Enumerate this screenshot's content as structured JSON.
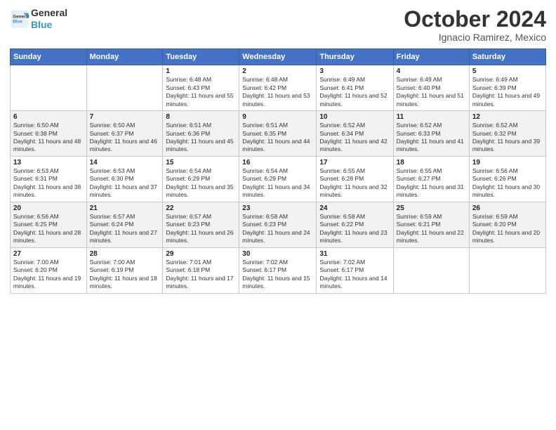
{
  "logo": {
    "line1": "General",
    "line2": "Blue"
  },
  "title": "October 2024",
  "location": "Ignacio Ramirez, Mexico",
  "days_of_week": [
    "Sunday",
    "Monday",
    "Tuesday",
    "Wednesday",
    "Thursday",
    "Friday",
    "Saturday"
  ],
  "weeks": [
    [
      {
        "day": "",
        "info": ""
      },
      {
        "day": "",
        "info": ""
      },
      {
        "day": "1",
        "info": "Sunrise: 6:48 AM\nSunset: 6:43 PM\nDaylight: 11 hours and 55 minutes."
      },
      {
        "day": "2",
        "info": "Sunrise: 6:48 AM\nSunset: 6:42 PM\nDaylight: 11 hours and 53 minutes."
      },
      {
        "day": "3",
        "info": "Sunrise: 6:49 AM\nSunset: 6:41 PM\nDaylight: 11 hours and 52 minutes."
      },
      {
        "day": "4",
        "info": "Sunrise: 6:49 AM\nSunset: 6:40 PM\nDaylight: 11 hours and 51 minutes."
      },
      {
        "day": "5",
        "info": "Sunrise: 6:49 AM\nSunset: 6:39 PM\nDaylight: 11 hours and 49 minutes."
      }
    ],
    [
      {
        "day": "6",
        "info": "Sunrise: 6:50 AM\nSunset: 6:38 PM\nDaylight: 11 hours and 48 minutes."
      },
      {
        "day": "7",
        "info": "Sunrise: 6:50 AM\nSunset: 6:37 PM\nDaylight: 11 hours and 46 minutes."
      },
      {
        "day": "8",
        "info": "Sunrise: 6:51 AM\nSunset: 6:36 PM\nDaylight: 11 hours and 45 minutes."
      },
      {
        "day": "9",
        "info": "Sunrise: 6:51 AM\nSunset: 6:35 PM\nDaylight: 11 hours and 44 minutes."
      },
      {
        "day": "10",
        "info": "Sunrise: 6:52 AM\nSunset: 6:34 PM\nDaylight: 11 hours and 42 minutes."
      },
      {
        "day": "11",
        "info": "Sunrise: 6:52 AM\nSunset: 6:33 PM\nDaylight: 11 hours and 41 minutes."
      },
      {
        "day": "12",
        "info": "Sunrise: 6:52 AM\nSunset: 6:32 PM\nDaylight: 11 hours and 39 minutes."
      }
    ],
    [
      {
        "day": "13",
        "info": "Sunrise: 6:53 AM\nSunset: 6:31 PM\nDaylight: 11 hours and 38 minutes."
      },
      {
        "day": "14",
        "info": "Sunrise: 6:53 AM\nSunset: 6:30 PM\nDaylight: 11 hours and 37 minutes."
      },
      {
        "day": "15",
        "info": "Sunrise: 6:54 AM\nSunset: 6:29 PM\nDaylight: 11 hours and 35 minutes."
      },
      {
        "day": "16",
        "info": "Sunrise: 6:54 AM\nSunset: 6:29 PM\nDaylight: 11 hours and 34 minutes."
      },
      {
        "day": "17",
        "info": "Sunrise: 6:55 AM\nSunset: 6:28 PM\nDaylight: 11 hours and 32 minutes."
      },
      {
        "day": "18",
        "info": "Sunrise: 6:55 AM\nSunset: 6:27 PM\nDaylight: 11 hours and 31 minutes."
      },
      {
        "day": "19",
        "info": "Sunrise: 6:56 AM\nSunset: 6:26 PM\nDaylight: 11 hours and 30 minutes."
      }
    ],
    [
      {
        "day": "20",
        "info": "Sunrise: 6:56 AM\nSunset: 6:25 PM\nDaylight: 11 hours and 28 minutes."
      },
      {
        "day": "21",
        "info": "Sunrise: 6:57 AM\nSunset: 6:24 PM\nDaylight: 11 hours and 27 minutes."
      },
      {
        "day": "22",
        "info": "Sunrise: 6:57 AM\nSunset: 6:23 PM\nDaylight: 11 hours and 26 minutes."
      },
      {
        "day": "23",
        "info": "Sunrise: 6:58 AM\nSunset: 6:23 PM\nDaylight: 11 hours and 24 minutes."
      },
      {
        "day": "24",
        "info": "Sunrise: 6:58 AM\nSunset: 6:22 PM\nDaylight: 11 hours and 23 minutes."
      },
      {
        "day": "25",
        "info": "Sunrise: 6:59 AM\nSunset: 6:21 PM\nDaylight: 11 hours and 22 minutes."
      },
      {
        "day": "26",
        "info": "Sunrise: 6:59 AM\nSunset: 6:20 PM\nDaylight: 11 hours and 20 minutes."
      }
    ],
    [
      {
        "day": "27",
        "info": "Sunrise: 7:00 AM\nSunset: 6:20 PM\nDaylight: 11 hours and 19 minutes."
      },
      {
        "day": "28",
        "info": "Sunrise: 7:00 AM\nSunset: 6:19 PM\nDaylight: 11 hours and 18 minutes."
      },
      {
        "day": "29",
        "info": "Sunrise: 7:01 AM\nSunset: 6:18 PM\nDaylight: 11 hours and 17 minutes."
      },
      {
        "day": "30",
        "info": "Sunrise: 7:02 AM\nSunset: 6:17 PM\nDaylight: 11 hours and 15 minutes."
      },
      {
        "day": "31",
        "info": "Sunrise: 7:02 AM\nSunset: 6:17 PM\nDaylight: 11 hours and 14 minutes."
      },
      {
        "day": "",
        "info": ""
      },
      {
        "day": "",
        "info": ""
      }
    ]
  ]
}
